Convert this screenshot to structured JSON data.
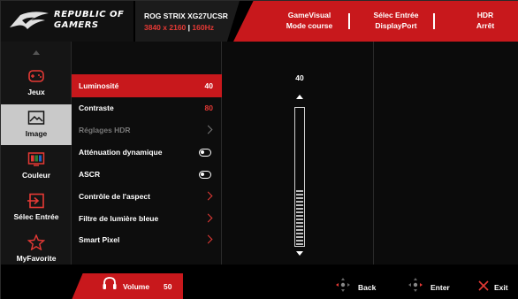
{
  "header": {
    "brand_line1": "REPUBLIC OF",
    "brand_line2": "GAMERS",
    "model": "ROG STRIX XG27UCSR",
    "resolution": "3840 x 2160",
    "refresh": "160Hz",
    "status": [
      {
        "line1": "GameVisual",
        "line2": "Mode course"
      },
      {
        "line1": "Sélec Entrée",
        "line2": "DisplayPort"
      },
      {
        "line1": "HDR",
        "line2": "Arrêt"
      }
    ]
  },
  "sidebar": {
    "items": [
      {
        "label": "Jeux",
        "icon": "gamepad-icon",
        "active": false
      },
      {
        "label": "Image",
        "icon": "image-icon",
        "active": true
      },
      {
        "label": "Couleur",
        "icon": "color-icon",
        "active": false
      },
      {
        "label": "Sélec Entrée",
        "icon": "input-icon",
        "active": false
      },
      {
        "label": "MyFavorite",
        "icon": "star-icon",
        "active": false
      }
    ]
  },
  "menu": {
    "items": [
      {
        "label": "Luminosité",
        "value": "40",
        "type": "value",
        "active": true
      },
      {
        "label": "Contraste",
        "value": "80",
        "type": "value"
      },
      {
        "label": "Réglages HDR",
        "type": "submenu",
        "disabled": true
      },
      {
        "label": "Atténuation dynamique",
        "type": "toggle",
        "state": "off"
      },
      {
        "label": "ASCR",
        "type": "toggle",
        "state": "off"
      },
      {
        "label": "Contrôle de l'aspect",
        "type": "submenu"
      },
      {
        "label": "Filtre de lumière bleue",
        "type": "submenu"
      },
      {
        "label": "Smart Pixel",
        "type": "submenu"
      }
    ]
  },
  "slider": {
    "value": "40",
    "level_fraction": 0.4
  },
  "footer": {
    "volume_label": "Volume",
    "volume_value": "50",
    "back_label": "Back",
    "enter_label": "Enter",
    "exit_label": "Exit"
  },
  "colors": {
    "accent_red": "#c8181c",
    "value_red": "#e53935",
    "active_side": "#c9c9c9"
  }
}
